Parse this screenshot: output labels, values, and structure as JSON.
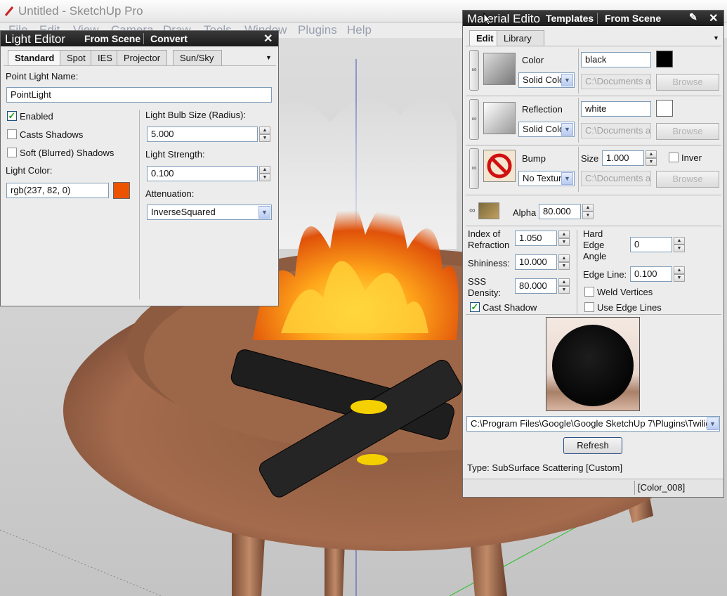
{
  "app": {
    "title": "Untitled - SketchUp Pro",
    "menu": [
      "File",
      "Edit",
      "View",
      "Camera",
      "Draw",
      "Tools",
      "Window",
      "Plugins",
      "Help"
    ]
  },
  "light_editor": {
    "title": "Light Editor",
    "links": [
      "From Scene",
      "Convert"
    ],
    "tabs": [
      "Standard",
      "Spot",
      "IES",
      "Projector",
      "Sun/Sky"
    ],
    "name_label": "Point Light Name:",
    "name_value": "PointLight",
    "enabled_label": "Enabled",
    "enabled": true,
    "casts_shadows_label": "Casts Shadows",
    "casts_shadows": false,
    "soft_shadows_label": "Soft (Blurred) Shadows",
    "soft_shadows": false,
    "light_color_label": "Light Color:",
    "light_color_value": "rgb(237, 82, 0)",
    "light_color_hex": "#ed5200",
    "bulb_size_label": "Light Bulb Size (Radius):",
    "bulb_size_value": "5.000",
    "strength_label": "Light Strength:",
    "strength_value": "0.100",
    "attenuation_label": "Attenuation:",
    "attenuation_value": "InverseSquared"
  },
  "material_editor": {
    "title": "Material Edito",
    "links": [
      "Templates",
      "From Scene"
    ],
    "tabs": [
      "Edit",
      "Library"
    ],
    "color": {
      "label": "Color",
      "type": "Solid Colo",
      "value": "black",
      "path": "C:\\Documents an",
      "browse": "Browse",
      "swatch": "#000000"
    },
    "reflection": {
      "label": "Reflection",
      "type": "Solid Colo",
      "value": "white",
      "path": "C:\\Documents an",
      "browse": "Browse",
      "swatch": "#ffffff"
    },
    "bump": {
      "label": "Bump",
      "type": "No Textur",
      "size_label": "Size",
      "size_value": "1.000",
      "invert_label": "Inver",
      "path": "C:\\Documents an",
      "browse": "Browse"
    },
    "alpha_label": "Alpha",
    "alpha_value": "80.000",
    "ior_label_1": "Index of",
    "ior_label_2": "Refraction",
    "ior_value": "1.050",
    "shininess_label": "Shininess:",
    "shininess_value": "10.000",
    "sss_label_1": "SSS",
    "sss_label_2": "Density:",
    "sss_value": "80.000",
    "cast_shadow_label": "Cast Shadow",
    "cast_shadow": true,
    "hard_edge_label_1": "Hard",
    "hard_edge_label_2": "Edge",
    "hard_edge_label_3": "Angle",
    "hard_edge_value": "0",
    "edge_line_label": "Edge Line:",
    "edge_line_value": "0.100",
    "weld_label": "Weld Vertices",
    "use_edge_label": "Use Edge Lines",
    "preset_path": "C:\\Program Files\\Google\\Google SketchUp 7\\Plugins\\Twilig",
    "refresh": "Refresh",
    "type_text": "Type: SubSurface Scattering [Custom]",
    "status": "[Color_008]"
  }
}
